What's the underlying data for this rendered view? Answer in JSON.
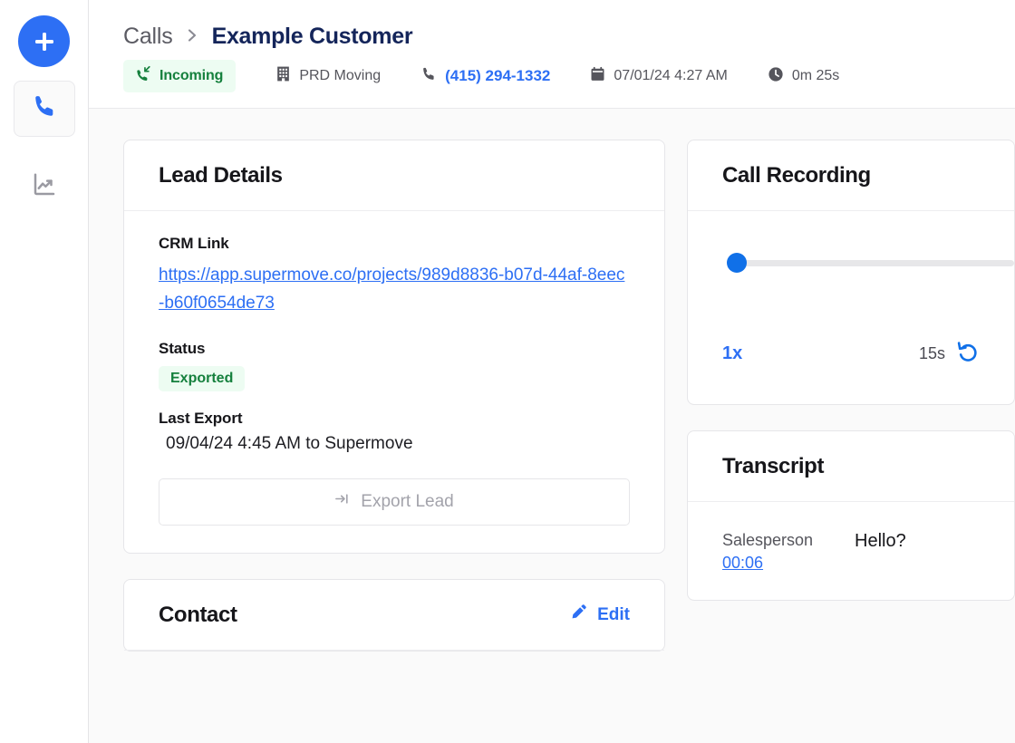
{
  "sidebar": {
    "add_button": {
      "icon": "plus-icon",
      "label": "Add"
    },
    "items": [
      {
        "icon": "phone-icon",
        "label": "Calls",
        "active": true
      },
      {
        "icon": "trending-up-chart-icon",
        "label": "Reports",
        "active": false
      }
    ]
  },
  "header": {
    "breadcrumb": {
      "root": "Calls",
      "separator": ">",
      "current": "Example Customer"
    },
    "meta": {
      "direction_badge": {
        "label": "Incoming",
        "icon": "incoming-call-icon",
        "bg": "#EDFCF2",
        "fg": "#15803D"
      },
      "organization": {
        "label": "PRD Moving",
        "icon": "building-icon"
      },
      "phone": {
        "label": "(415) 294-1332",
        "icon": "phone-icon",
        "color": "#2D6FF4"
      },
      "datetime": {
        "label": "07/01/24 4:27 AM",
        "icon": "calendar-icon"
      },
      "duration": {
        "label": "0m 25s",
        "icon": "clock-icon"
      }
    }
  },
  "lead_details": {
    "title": "Lead Details",
    "crm_link_label": "CRM Link",
    "crm_link_value": "https://app.supermove.co/projects/989d8836-b07d-44af-8eec-b60f0654de73",
    "status_label": "Status",
    "status_value": "Exported",
    "last_export_label": "Last Export",
    "last_export_value": "09/04/24 4:45 AM to Supermove",
    "export_button": {
      "label": "Export Lead",
      "icon": "export-arrow-icon",
      "disabled": true
    }
  },
  "contact": {
    "title": "Contact",
    "edit_label": "Edit",
    "edit_icon": "pencil-icon"
  },
  "call_recording": {
    "title": "Call Recording",
    "progress_percent": 0,
    "speed_label": "1x",
    "skip_label": "15s",
    "skip_icon": "rewind-15-icon"
  },
  "transcript": {
    "title": "Transcript",
    "entries": [
      {
        "speaker": "Salesperson",
        "time": "00:06",
        "text": "Hello?"
      }
    ]
  }
}
